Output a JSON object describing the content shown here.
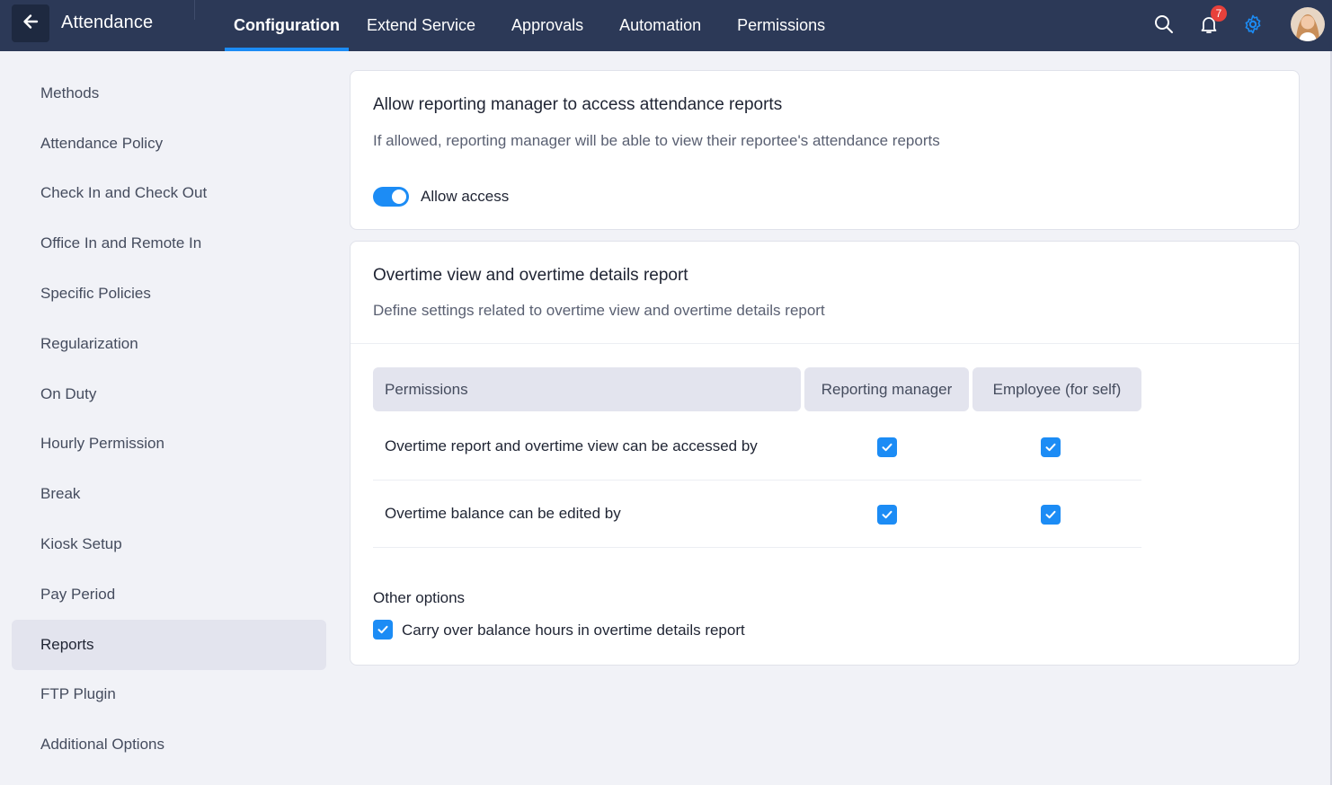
{
  "header": {
    "title": "Attendance",
    "tabs": [
      {
        "label": "Configuration",
        "active": true
      },
      {
        "label": "Extend Service",
        "active": false
      },
      {
        "label": "Approvals",
        "active": false
      },
      {
        "label": "Automation",
        "active": false
      },
      {
        "label": "Permissions",
        "active": false
      }
    ],
    "notification_count": "7",
    "icons": [
      "arrow-left-icon",
      "search-icon",
      "bell-icon",
      "gear-icon",
      "avatar"
    ],
    "accent_color": "#1c8cf5",
    "bar_color": "#2c3957"
  },
  "sidebar": {
    "items": [
      {
        "label": "Methods"
      },
      {
        "label": "Attendance Policy"
      },
      {
        "label": "Check In and Check Out"
      },
      {
        "label": "Office In and Remote In"
      },
      {
        "label": "Specific Policies"
      },
      {
        "label": "Regularization"
      },
      {
        "label": "On Duty"
      },
      {
        "label": "Hourly Permission"
      },
      {
        "label": "Break"
      },
      {
        "label": "Kiosk Setup"
      },
      {
        "label": "Pay Period"
      },
      {
        "label": "Reports",
        "active": true
      },
      {
        "label": "FTP Plugin"
      },
      {
        "label": "Additional Options"
      }
    ]
  },
  "access_card": {
    "title": "Allow reporting manager to access attendance reports",
    "description": "If allowed, reporting manager will be able to view their reportee's attendance reports",
    "toggle_label": "Allow access",
    "toggle_on": true
  },
  "overtime_card": {
    "title": "Overtime view and overtime details report",
    "description": "Define settings related to overtime view and overtime details report",
    "columns": [
      "Permissions",
      "Reporting manager",
      "Employee (for self)"
    ],
    "rows": [
      {
        "label": "Overtime report and overtime view can be accessed by",
        "reporting_manager": true,
        "employee": true
      },
      {
        "label": "Overtime balance can be edited by",
        "reporting_manager": true,
        "employee": true
      }
    ],
    "other_options_title": "Other options",
    "other_options": [
      {
        "label": "Carry over balance hours in overtime details report",
        "checked": true
      }
    ]
  }
}
